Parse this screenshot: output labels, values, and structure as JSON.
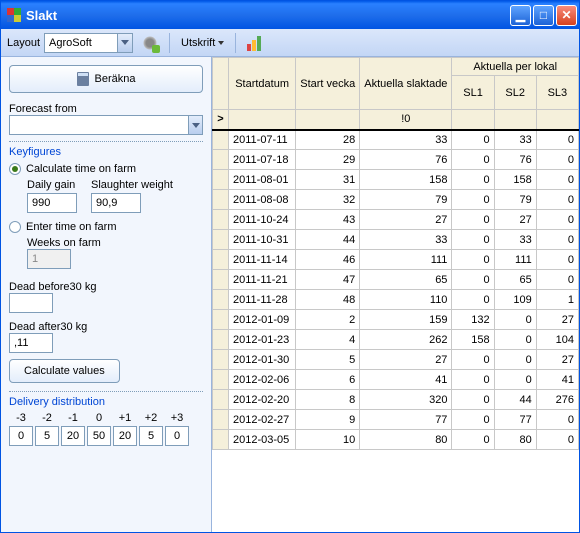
{
  "window": {
    "title": "Slakt"
  },
  "toolbar": {
    "layout_label": "Layout",
    "layout_value": "AgroSoft",
    "print_label": "Utskrift"
  },
  "left": {
    "calc_button": "Beräkna",
    "forecast_from": "Forecast from",
    "keyfigures": "Keyfigures",
    "calc_time": "Calculate time on farm",
    "daily_gain": "Daily gain",
    "daily_gain_val": "990",
    "slaughter_weight": "Slaughter weight",
    "slaughter_weight_val": "90,9",
    "enter_time": "Enter time on farm",
    "weeks_on_farm": "Weeks on farm",
    "weeks_val": "1",
    "dead_before": "Dead before30 kg",
    "dead_before_val": "",
    "dead_after": "Dead after30 kg",
    "dead_after_val": ",11",
    "calc_values": "Calculate values",
    "delivery_dist": "Delivery distribution",
    "dd_headers": [
      "-3",
      "-2",
      "-1",
      "0",
      "+1",
      "+2",
      "+3"
    ],
    "dd_values": [
      "0",
      "5",
      "20",
      "50",
      "20",
      "5",
      "0"
    ]
  },
  "grid": {
    "group_header": "Aktuella per lokal",
    "columns": [
      "Startdatum",
      "Start vecka",
      "Aktuella slaktade",
      "SL1",
      "SL2",
      "SL3"
    ],
    "summary_col2": "!0",
    "rows": [
      {
        "date": "2011-07-11",
        "wk": "28",
        "sl": "33",
        "s1": "0",
        "s2": "33",
        "s3": "0"
      },
      {
        "date": "2011-07-18",
        "wk": "29",
        "sl": "76",
        "s1": "0",
        "s2": "76",
        "s3": "0"
      },
      {
        "date": "2011-08-01",
        "wk": "31",
        "sl": "158",
        "s1": "0",
        "s2": "158",
        "s3": "0"
      },
      {
        "date": "2011-08-08",
        "wk": "32",
        "sl": "79",
        "s1": "0",
        "s2": "79",
        "s3": "0"
      },
      {
        "date": "2011-10-24",
        "wk": "43",
        "sl": "27",
        "s1": "0",
        "s2": "27",
        "s3": "0"
      },
      {
        "date": "2011-10-31",
        "wk": "44",
        "sl": "33",
        "s1": "0",
        "s2": "33",
        "s3": "0"
      },
      {
        "date": "2011-11-14",
        "wk": "46",
        "sl": "111",
        "s1": "0",
        "s2": "111",
        "s3": "0"
      },
      {
        "date": "2011-11-21",
        "wk": "47",
        "sl": "65",
        "s1": "0",
        "s2": "65",
        "s3": "0"
      },
      {
        "date": "2011-11-28",
        "wk": "48",
        "sl": "110",
        "s1": "0",
        "s2": "109",
        "s3": "1"
      },
      {
        "date": "2012-01-09",
        "wk": "2",
        "sl": "159",
        "s1": "132",
        "s2": "0",
        "s3": "27"
      },
      {
        "date": "2012-01-23",
        "wk": "4",
        "sl": "262",
        "s1": "158",
        "s2": "0",
        "s3": "104"
      },
      {
        "date": "2012-01-30",
        "wk": "5",
        "sl": "27",
        "s1": "0",
        "s2": "0",
        "s3": "27"
      },
      {
        "date": "2012-02-06",
        "wk": "6",
        "sl": "41",
        "s1": "0",
        "s2": "0",
        "s3": "41"
      },
      {
        "date": "2012-02-20",
        "wk": "8",
        "sl": "320",
        "s1": "0",
        "s2": "44",
        "s3": "276"
      },
      {
        "date": "2012-02-27",
        "wk": "9",
        "sl": "77",
        "s1": "0",
        "s2": "77",
        "s3": "0"
      },
      {
        "date": "2012-03-05",
        "wk": "10",
        "sl": "80",
        "s1": "0",
        "s2": "80",
        "s3": "0"
      }
    ]
  }
}
